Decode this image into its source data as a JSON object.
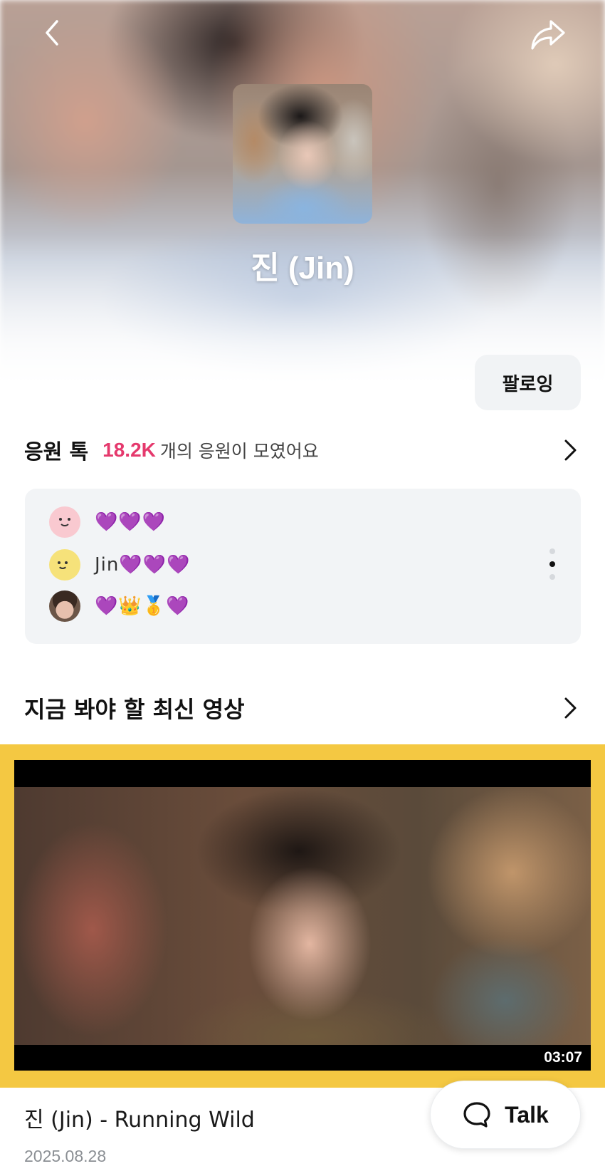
{
  "header": {
    "back_icon": "chevron-left-icon",
    "share_icon": "share-arrow-icon"
  },
  "profile": {
    "name": "진 (Jin)",
    "follow_label": "팔로잉"
  },
  "cheer_talk": {
    "title": "응원 톡",
    "count": "18.2K",
    "count_suffix": "개의 응원이 모였어요",
    "count_color": "#e5396d",
    "messages": [
      {
        "avatar": "pink-smile-avatar",
        "text": "💜💜💜"
      },
      {
        "avatar": "yellow-smile-avatar",
        "text": "Jin💜💜💜"
      },
      {
        "avatar": "photo-avatar",
        "text": "💜👑🥇💜"
      }
    ],
    "pager_active_index": 1
  },
  "latest_videos": {
    "title": "지금 봐야 할 최신 영상",
    "frame_color": "#f4c842",
    "video": {
      "title": "진 (Jin) - Running Wild",
      "date": "2025.08.28",
      "duration": "03:07"
    }
  },
  "fab": {
    "label": "Talk",
    "icon": "chat-bubble-icon"
  }
}
